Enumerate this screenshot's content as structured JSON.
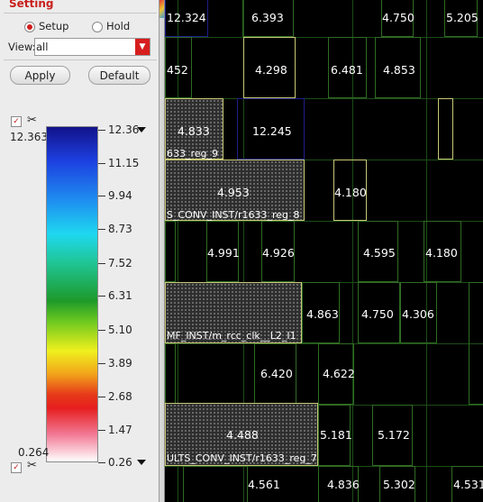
{
  "panel": {
    "title": "Setting",
    "mode_options": [
      "Setup",
      "Hold"
    ],
    "selected_mode": "Setup",
    "view_label": "View:",
    "view_value": "all",
    "apply_label": "Apply",
    "default_label": "Default",
    "max_value_label": "12.363",
    "min_value_label": "0.264"
  },
  "colors": {
    "accent": "#d21c1c",
    "cell_green": "#2f6b23",
    "cell_yellow": "#c8c877",
    "canvas_bg": "#000000"
  },
  "legend": {
    "ticks": [
      "12.36",
      "11.15",
      "9.94",
      "8.73",
      "7.52",
      "6.31",
      "5.10",
      "3.89",
      "2.68",
      "1.47",
      "0.26"
    ]
  },
  "canvas": {
    "cells": [
      "12.324",
      "6.393",
      "4.750",
      "5.205",
      "452",
      "4.298",
      "6.481",
      "4.853",
      "4.833",
      "12.245",
      "4.953",
      "4.180",
      "4.991",
      "4.926",
      "4.595",
      "4.180",
      "4.863",
      "4.750",
      "4.306",
      "6.420",
      "4.622",
      "4.488",
      "5.181",
      "5.172",
      "4.561",
      "4.836",
      "5.302",
      "4.531"
    ],
    "regions": [
      "633_reg_9",
      "S_CONV_INST/r1633_reg_8",
      "MF_INST/m_rcc_clk__L2_I1",
      "ULTS_CONV_INST/r1633_reg_7"
    ]
  }
}
